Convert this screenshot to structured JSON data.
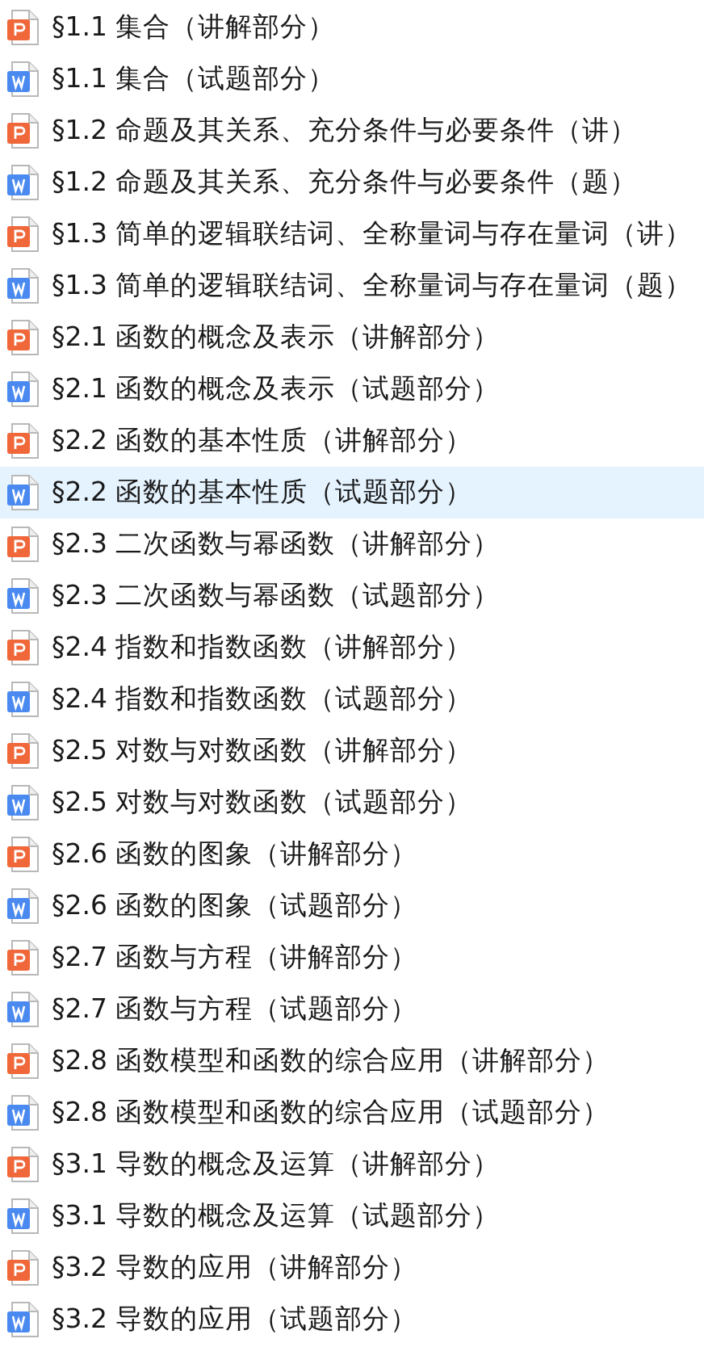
{
  "files": [
    {
      "kind": "ppt",
      "name": "§1.1 集合（讲解部分）",
      "selected": false
    },
    {
      "kind": "doc",
      "name": "§1.1 集合（试题部分）",
      "selected": false
    },
    {
      "kind": "ppt",
      "name": "§1.2 命题及其关系、充分条件与必要条件（讲）",
      "selected": false
    },
    {
      "kind": "doc",
      "name": "§1.2 命题及其关系、充分条件与必要条件（题）",
      "selected": false
    },
    {
      "kind": "ppt",
      "name": "§1.3 简单的逻辑联结词、全称量词与存在量词（讲）",
      "selected": false
    },
    {
      "kind": "doc",
      "name": "§1.3 简单的逻辑联结词、全称量词与存在量词（题）",
      "selected": false
    },
    {
      "kind": "ppt",
      "name": "§2.1 函数的概念及表示（讲解部分）",
      "selected": false
    },
    {
      "kind": "doc",
      "name": "§2.1 函数的概念及表示（试题部分）",
      "selected": false
    },
    {
      "kind": "ppt",
      "name": "§2.2 函数的基本性质（讲解部分）",
      "selected": false
    },
    {
      "kind": "doc",
      "name": "§2.2 函数的基本性质（试题部分）",
      "selected": true
    },
    {
      "kind": "ppt",
      "name": "§2.3 二次函数与幂函数（讲解部分）",
      "selected": false
    },
    {
      "kind": "doc",
      "name": "§2.3 二次函数与幂函数（试题部分）",
      "selected": false
    },
    {
      "kind": "ppt",
      "name": "§2.4 指数和指数函数（讲解部分）",
      "selected": false
    },
    {
      "kind": "doc",
      "name": "§2.4 指数和指数函数（试题部分）",
      "selected": false
    },
    {
      "kind": "ppt",
      "name": "§2.5 对数与对数函数（讲解部分）",
      "selected": false
    },
    {
      "kind": "doc",
      "name": "§2.5 对数与对数函数（试题部分）",
      "selected": false
    },
    {
      "kind": "ppt",
      "name": "§2.6 函数的图象（讲解部分）",
      "selected": false
    },
    {
      "kind": "doc",
      "name": "§2.6 函数的图象（试题部分）",
      "selected": false
    },
    {
      "kind": "ppt",
      "name": "§2.7 函数与方程（讲解部分）",
      "selected": false
    },
    {
      "kind": "doc",
      "name": "§2.7 函数与方程（试题部分）",
      "selected": false
    },
    {
      "kind": "ppt",
      "name": "§2.8 函数模型和函数的综合应用（讲解部分）",
      "selected": false
    },
    {
      "kind": "doc",
      "name": "§2.8 函数模型和函数的综合应用（试题部分）",
      "selected": false
    },
    {
      "kind": "ppt",
      "name": "§3.1 导数的概念及运算（讲解部分）",
      "selected": false
    },
    {
      "kind": "doc",
      "name": "§3.1 导数的概念及运算（试题部分）",
      "selected": false
    },
    {
      "kind": "ppt",
      "name": "§3.2 导数的应用（讲解部分）",
      "selected": false
    },
    {
      "kind": "doc",
      "name": "§3.2 导数的应用（试题部分）",
      "selected": false
    }
  ]
}
